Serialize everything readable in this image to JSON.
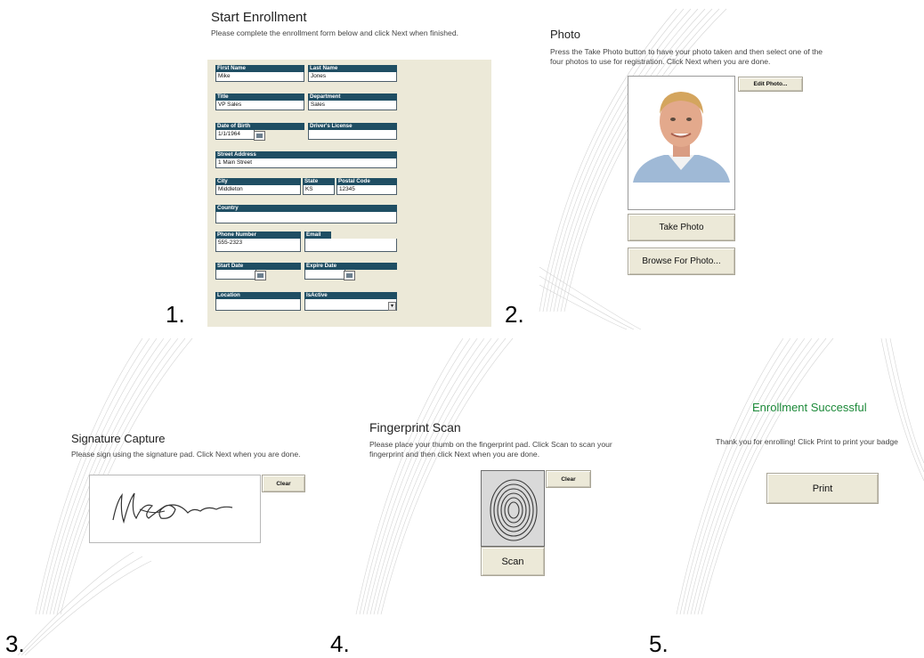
{
  "steps": {
    "s1": "1.",
    "s2": "2.",
    "s3": "3.",
    "s4": "4.",
    "s5": "5."
  },
  "enrollment": {
    "title": "Start Enrollment",
    "description": "Please complete the enrollment form below and click Next when finished.",
    "fields": {
      "first_name": {
        "label": "First Name",
        "value": "Mike"
      },
      "last_name": {
        "label": "Last Name",
        "value": "Jones"
      },
      "title": {
        "label": "Title",
        "value": "VP Sales"
      },
      "department": {
        "label": "Department",
        "value": "Sales"
      },
      "dob": {
        "label": "Date of Birth",
        "value": "1/1/1964"
      },
      "drivers_license": {
        "label": "Driver's License",
        "value": ""
      },
      "street": {
        "label": "Street Address",
        "value": "1 Main Street"
      },
      "city": {
        "label": "City",
        "value": "Middleton"
      },
      "state": {
        "label": "State",
        "value": "KS"
      },
      "postal": {
        "label": "Postal Code",
        "value": "12345"
      },
      "country": {
        "label": "Country",
        "value": ""
      },
      "phone": {
        "label": "Phone Number",
        "value": "555-2323"
      },
      "email": {
        "label": "Email",
        "value": ""
      },
      "start_date": {
        "label": "Start Date",
        "value": ""
      },
      "expire_date": {
        "label": "Expire Date",
        "value": ""
      },
      "location": {
        "label": "Location",
        "value": ""
      },
      "isactive": {
        "label": "IsActive",
        "value": ""
      }
    }
  },
  "photo": {
    "title": "Photo",
    "description": "Press the Take Photo button to have your photo taken and then select one of the four photos to use for registration. Click Next when you are done.",
    "edit_label": "Edit Photo...",
    "take_label": "Take Photo",
    "browse_label": "Browse For Photo..."
  },
  "signature": {
    "title": "Signature Capture",
    "description": "Please sign using the signature pad. Click Next when you are done.",
    "clear_label": "Clear"
  },
  "fingerprint": {
    "title": "Fingerprint Scan",
    "description": "Please place your thumb on the fingerprint pad. Click Scan to scan your fingerprint and then click Next when you are done.",
    "clear_label": "Clear",
    "scan_label": "Scan"
  },
  "success": {
    "title": "Enrollment Successful",
    "description": "Thank you for enrolling! Click Print to print your badge",
    "print_label": "Print"
  },
  "colors": {
    "field_header": "#1f4e63",
    "form_bg": "#ece9d8",
    "success_text": "#1d8a3a"
  }
}
